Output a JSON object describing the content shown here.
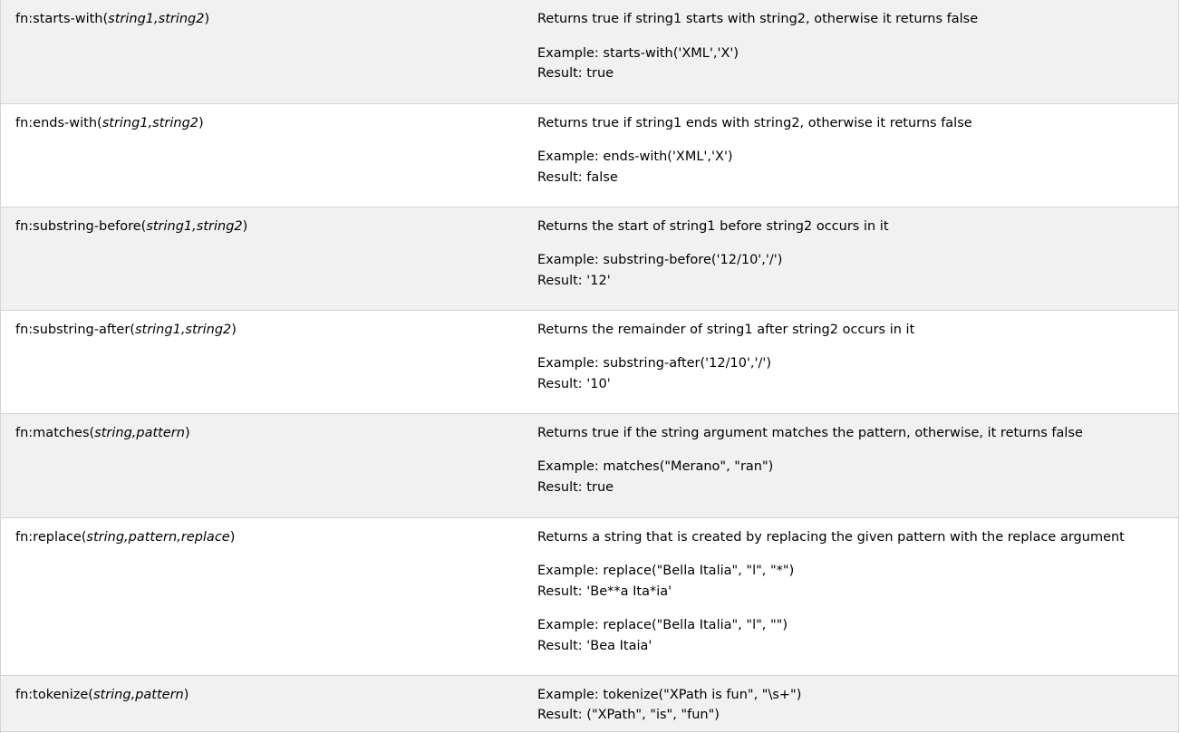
{
  "rows": [
    {
      "fn": {
        "prefix": "fn:starts-with(",
        "arg1": "string1",
        "sep1": ",",
        "arg2": "string2",
        "suffix": ")"
      },
      "description": "Returns true if string1 starts with string2, otherwise it returns false",
      "examples": [
        {
          "example": "Example: starts-with('XML','X')",
          "result": "Result: true"
        }
      ]
    },
    {
      "fn": {
        "prefix": "fn:ends-with(",
        "arg1": "string1",
        "sep1": ",",
        "arg2": "string2",
        "suffix": ")"
      },
      "description": "Returns true if string1 ends with string2, otherwise it returns false",
      "examples": [
        {
          "example": "Example: ends-with('XML','X')",
          "result": "Result: false"
        }
      ]
    },
    {
      "fn": {
        "prefix": "fn:substring-before(",
        "arg1": "string1",
        "sep1": ",",
        "arg2": "string2",
        "suffix": ")"
      },
      "description": "Returns the start of string1 before string2 occurs in it",
      "examples": [
        {
          "example": "Example: substring-before('12/10','/')",
          "result": "Result: '12'"
        }
      ]
    },
    {
      "fn": {
        "prefix": "fn:substring-after(",
        "arg1": "string1",
        "sep1": ",",
        "arg2": "string2",
        "suffix": ")"
      },
      "description": "Returns the remainder of string1 after string2 occurs in it",
      "examples": [
        {
          "example": "Example: substring-after('12/10','/')",
          "result": "Result: '10'"
        }
      ]
    },
    {
      "fn": {
        "prefix": "fn:matches(",
        "arg1": "string",
        "sep1": ",",
        "arg2": "pattern",
        "suffix": ")"
      },
      "description": "Returns true if the string argument matches the pattern, otherwise, it returns false",
      "examples": [
        {
          "example": "Example: matches(\"Merano\", \"ran\")",
          "result": "Result: true"
        }
      ]
    },
    {
      "fn": {
        "prefix": "fn:replace(",
        "arg1": "string",
        "sep1": ",",
        "arg2": "pattern",
        "sep2": ",",
        "arg3": "replace",
        "suffix": ")"
      },
      "description": "Returns a string that is created by replacing the given pattern with the replace argument",
      "examples": [
        {
          "example": "Example: replace(\"Bella Italia\", \"l\", \"*\")",
          "result": "Result: 'Be**a Ita*ia'"
        },
        {
          "example": "Example: replace(\"Bella Italia\", \"l\", \"\")",
          "result": "Result: 'Bea Itaia'"
        }
      ]
    },
    {
      "fn": {
        "prefix": "fn:tokenize(",
        "arg1": "string",
        "sep1": ",",
        "arg2": "pattern",
        "suffix": ")"
      },
      "description": "",
      "examples": [
        {
          "example": "Example: tokenize(\"XPath is fun\", \"\\s+\")",
          "result": "Result: (\"XPath\", \"is\", \"fun\")"
        }
      ]
    }
  ]
}
